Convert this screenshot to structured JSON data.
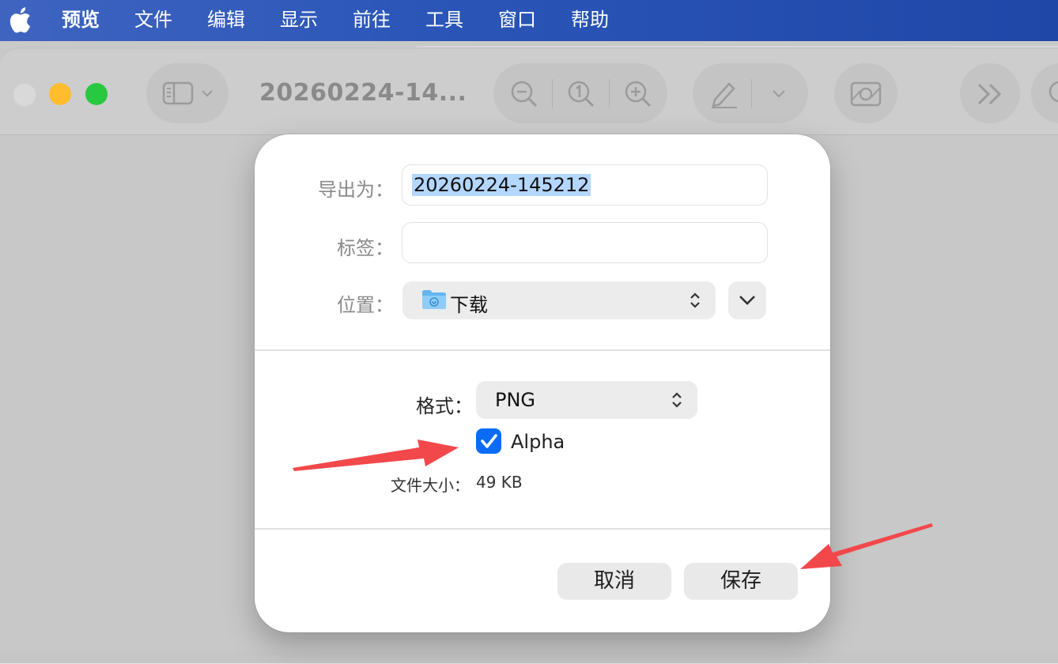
{
  "menubar": {
    "items": [
      "预览",
      "文件",
      "编辑",
      "显示",
      "前往",
      "工具",
      "窗口",
      "帮助"
    ]
  },
  "window": {
    "title": "20260224-14...",
    "traffic_colors": [
      "#d9d9d9",
      "#ffbd2e",
      "#28c840"
    ]
  },
  "dialog": {
    "export_as_label": "导出为：",
    "export_as_value": "20260224-145212",
    "tags_label": "标签：",
    "tags_value": "",
    "location_label": "位置：",
    "location_value": "下载",
    "format_label": "格式：",
    "format_value": "PNG",
    "alpha_label": "Alpha",
    "alpha_checked": true,
    "filesize_label": "文件大小：",
    "filesize_value": "49 KB",
    "cancel_label": "取消",
    "save_label": "保存"
  },
  "colors": {
    "accent": "#0a6cf5",
    "selection": "#b3d7ff",
    "annotation_arrow": "#f2484b"
  },
  "icons": [
    "apple-icon",
    "sidebar-icon",
    "chevron-down-icon",
    "zoom-out-icon",
    "actual-size-icon",
    "zoom-in-icon",
    "markup-pen-icon",
    "crop-icon",
    "more-icon",
    "search-icon",
    "folder-icon",
    "updown-chevron-icon",
    "checkmark-icon"
  ]
}
